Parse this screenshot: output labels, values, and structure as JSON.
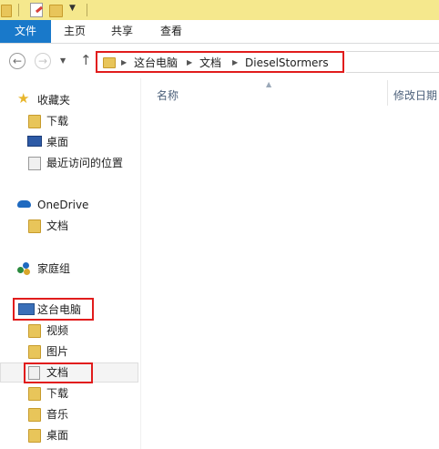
{
  "ribbon": {
    "tabs": [
      {
        "label": "文件"
      },
      {
        "label": "主页"
      },
      {
        "label": "共享"
      },
      {
        "label": "查看"
      }
    ]
  },
  "address": {
    "crumbs": [
      "这台电脑",
      "文档",
      "DieselStormers"
    ]
  },
  "columns": {
    "name": "名称",
    "modified": "修改日期"
  },
  "nav": {
    "favorites": {
      "label": "收藏夹",
      "items": [
        "下载",
        "桌面",
        "最近访问的位置"
      ]
    },
    "onedrive": {
      "label": "OneDrive",
      "items": [
        "文档"
      ]
    },
    "homegroup": {
      "label": "家庭组"
    },
    "thispc": {
      "label": "这台电脑",
      "items": [
        "视频",
        "图片",
        "文档",
        "下载",
        "音乐",
        "桌面"
      ]
    }
  },
  "colors": {
    "accent": "#1979ca",
    "highlight": "#e11c1c",
    "titlebar": "#f5e88d"
  }
}
